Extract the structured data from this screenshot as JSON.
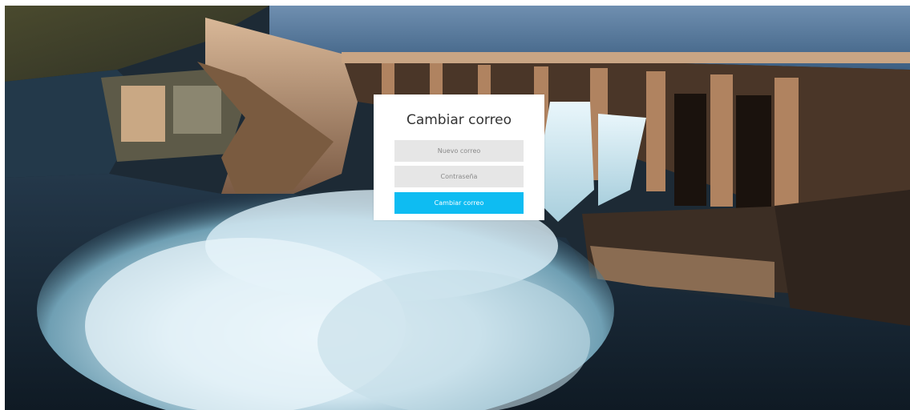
{
  "background": {
    "description_icon": "dam-spillway-photo-icon"
  },
  "form": {
    "title": "Cambiar correo",
    "email_placeholder": "Nuevo correo",
    "email_value": "",
    "password_placeholder": "Contraseña",
    "password_value": "",
    "submit_label": "Cambiar correo"
  },
  "colors": {
    "accent": "#0ebcf2",
    "field_bg": "#e6e6e6",
    "card_bg": "#ffffff"
  }
}
